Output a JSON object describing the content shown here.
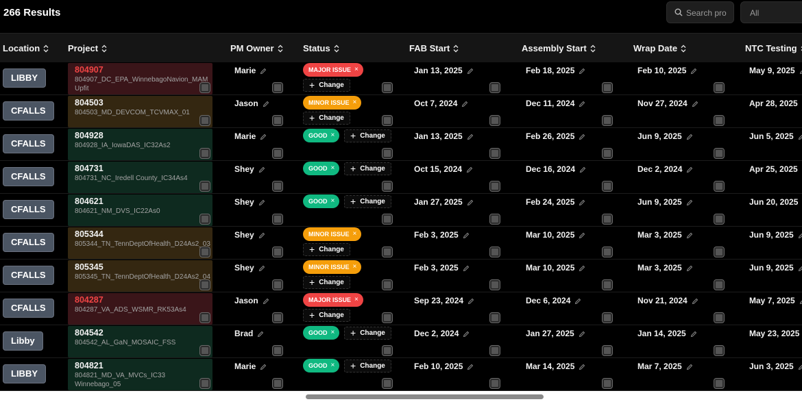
{
  "header": {
    "results_label": "266 Results",
    "search_placeholder": "Search pro",
    "filter_value": "All"
  },
  "columns": [
    "Location",
    "Project",
    "PM Owner",
    "Status",
    "FAB Start",
    "Assembly Start",
    "Wrap Date",
    "NTC Testing"
  ],
  "change_label": "Change",
  "status_colors": {
    "MAJOR ISSUE": "#ef4444",
    "MINOR ISSUE": "#f59e0b",
    "GOOD": "#10b981"
  },
  "rows": [
    {
      "location": "LIBBY",
      "project_number": "804907",
      "project_name": "804907_DC_EPA_WinnebagoNavion_MAM Upfit",
      "owner": "Marie",
      "status": "MAJOR ISSUE",
      "fab_start": "Jan 13, 2025",
      "assembly_start": "Feb 18, 2025",
      "wrap_date": "Feb 10, 2025",
      "ntc_testing": "May 9, 2025"
    },
    {
      "location": "CFALLS",
      "project_number": "804503",
      "project_name": "804503_MD_DEVCOM_TCVMAX_01",
      "owner": "Jason",
      "status": "MINOR ISSUE",
      "fab_start": "Oct 7, 2024",
      "assembly_start": "Dec 11, 2024",
      "wrap_date": "Nov 27, 2024",
      "ntc_testing": "Apr 28, 2025"
    },
    {
      "location": "CFALLS",
      "project_number": "804928",
      "project_name": "804928_IA_IowaDAS_IC32As2",
      "owner": "Marie",
      "status": "GOOD",
      "fab_start": "Jan 13, 2025",
      "assembly_start": "Feb 26, 2025",
      "wrap_date": "Jun 9, 2025",
      "ntc_testing": "Jun 5, 2025"
    },
    {
      "location": "CFALLS",
      "project_number": "804731",
      "project_name": "804731_NC_Iredell County_IC34As4",
      "owner": "Shey",
      "status": "GOOD",
      "fab_start": "Oct 15, 2024",
      "assembly_start": "Dec 16, 2024",
      "wrap_date": "Dec 2, 2024",
      "ntc_testing": "Apr 25, 2025"
    },
    {
      "location": "CFALLS",
      "project_number": "804621",
      "project_name": "804621_NM_DVS_IC22As0",
      "owner": "Shey",
      "status": "GOOD",
      "fab_start": "Jan 27, 2025",
      "assembly_start": "Feb 24, 2025",
      "wrap_date": "Jun 9, 2025",
      "ntc_testing": "Jun 20, 2025"
    },
    {
      "location": "CFALLS",
      "project_number": "805344",
      "project_name": "805344_TN_TennDeptOfHealth_D24As2_03",
      "owner": "Shey",
      "status": "MINOR ISSUE",
      "fab_start": "Feb 3, 2025",
      "assembly_start": "Mar 10, 2025",
      "wrap_date": "Mar 3, 2025",
      "ntc_testing": "Jun 9, 2025"
    },
    {
      "location": "CFALLS",
      "project_number": "805345",
      "project_name": "805345_TN_TennDeptOfHealth_D24As2_04",
      "owner": "Shey",
      "status": "MINOR ISSUE",
      "fab_start": "Feb 3, 2025",
      "assembly_start": "Mar 10, 2025",
      "wrap_date": "Mar 3, 2025",
      "ntc_testing": "Jun 9, 2025"
    },
    {
      "location": "CFALLS",
      "project_number": "804287",
      "project_name": "804287_VA_ADS_WSMR_RK53As4",
      "owner": "Jason",
      "status": "MAJOR ISSUE",
      "fab_start": "Sep 23, 2024",
      "assembly_start": "Dec 6, 2024",
      "wrap_date": "Nov 21, 2024",
      "ntc_testing": "May 7, 2025"
    },
    {
      "location": "Libby",
      "project_number": "804542",
      "project_name": "804542_AL_GaN_MOSAIC_FSS",
      "owner": "Brad",
      "status": "GOOD",
      "fab_start": "Dec 2, 2024",
      "assembly_start": "Jan 27, 2025",
      "wrap_date": "Jan 14, 2025",
      "ntc_testing": "May 23, 2025"
    },
    {
      "location": "LIBBY",
      "project_number": "804821",
      "project_name": "804821_MD_VA_MVCs_IC33 Winnebago_05",
      "owner": "Marie",
      "status": "GOOD",
      "fab_start": "Feb 10, 2025",
      "assembly_start": "Mar 14, 2025",
      "wrap_date": "Mar 7, 2025",
      "ntc_testing": "Jun 3, 2025"
    }
  ]
}
